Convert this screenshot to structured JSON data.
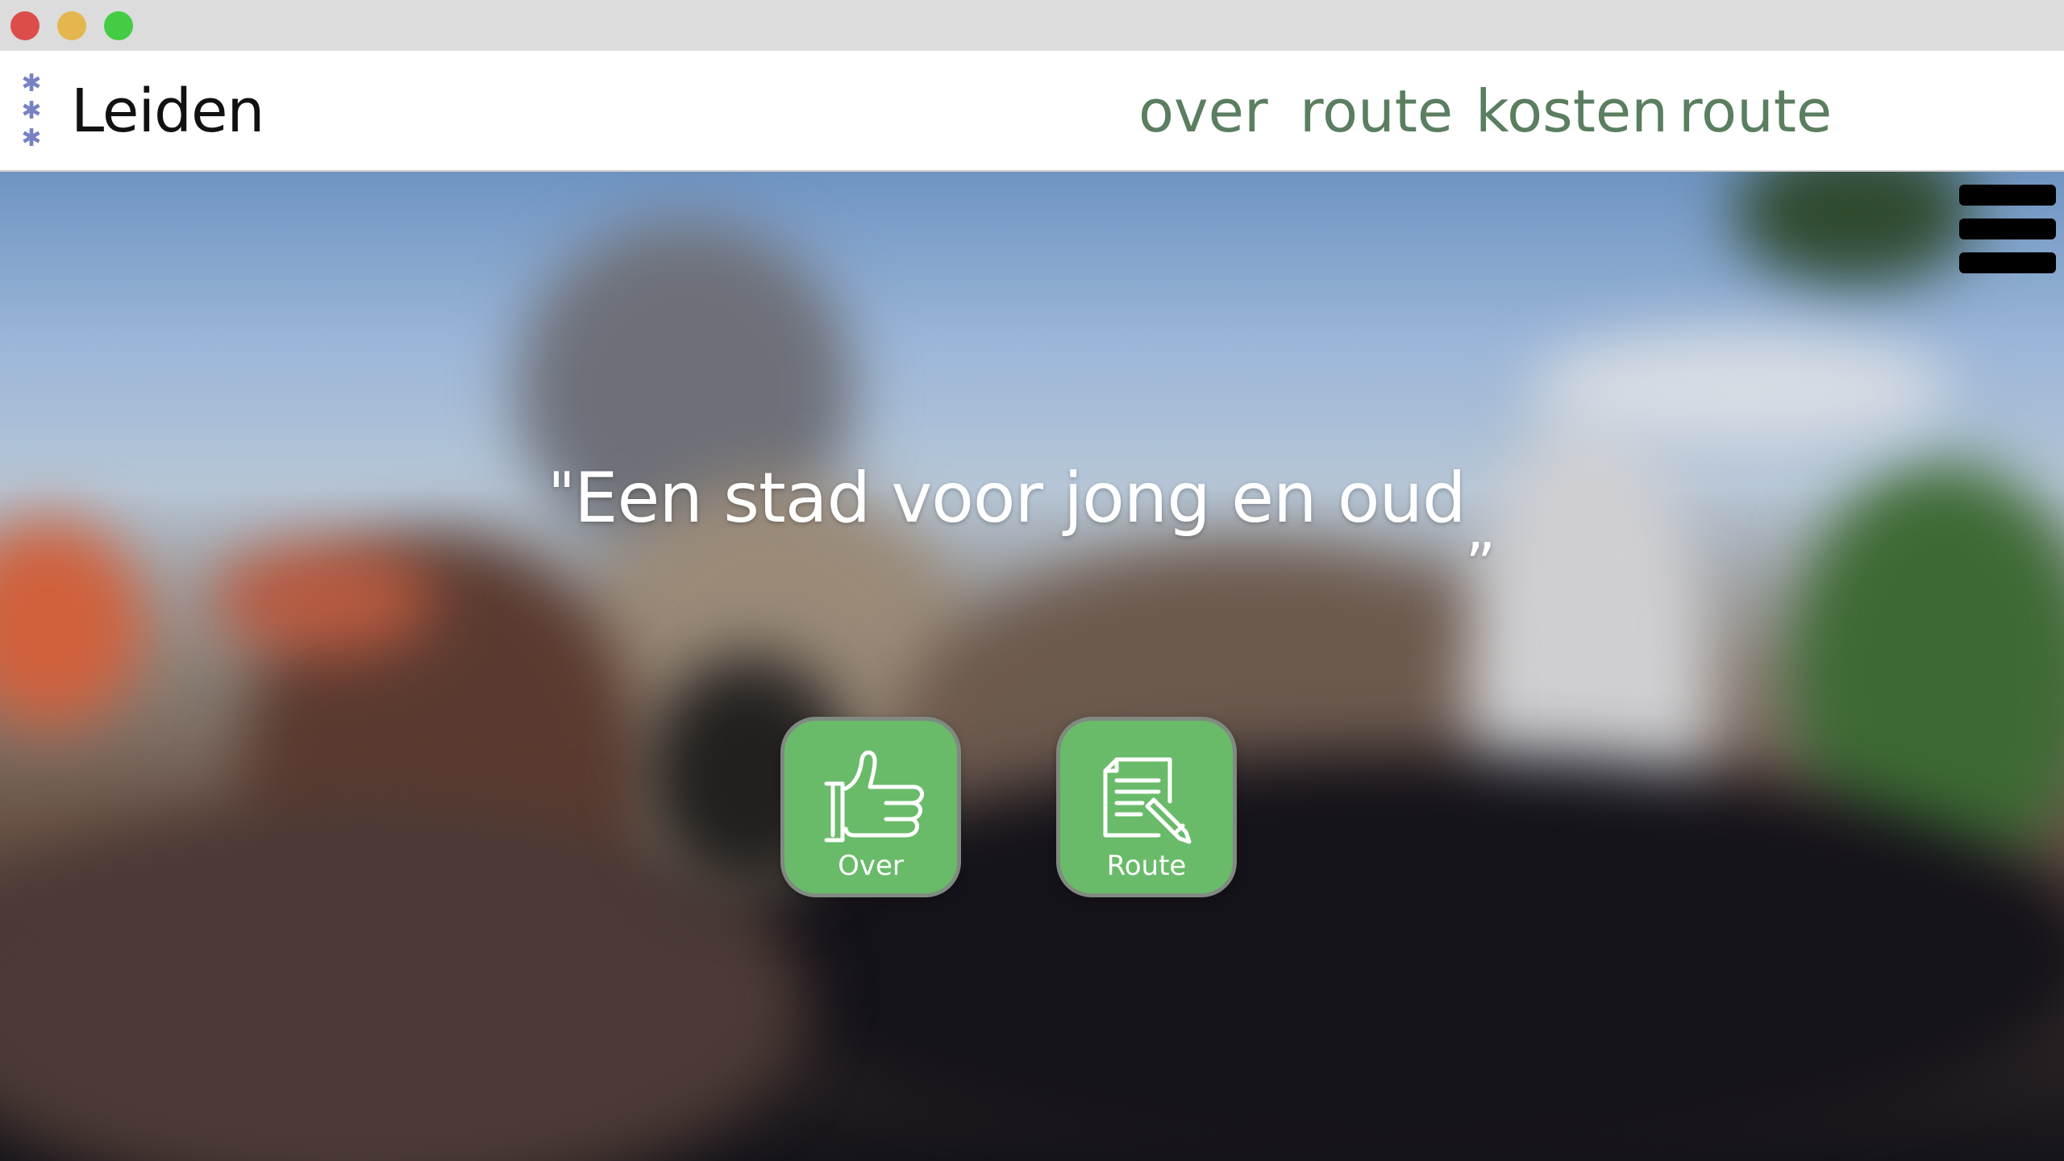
{
  "window": {
    "controls": [
      "close",
      "minimize",
      "maximize"
    ]
  },
  "header": {
    "logo_icon": "puzzle-icon",
    "logo_text": "Leiden",
    "nav": [
      {
        "label": "over"
      },
      {
        "label": "route"
      },
      {
        "label": "kosten"
      },
      {
        "label": "route"
      }
    ]
  },
  "hero": {
    "quote_open": "\"",
    "quote_text": "Een stad voor jong en oud",
    "quote_close": "„",
    "menu_icon": "hamburger-menu-icon",
    "tiles": [
      {
        "label": "Over",
        "icon": "thumbs-up-icon"
      },
      {
        "label": "Route",
        "icon": "document-pencil-icon"
      }
    ]
  },
  "colors": {
    "nav_text": "#5a7e5f",
    "tile_green": "#69bb6a",
    "logo_accent": "#7782c4"
  }
}
